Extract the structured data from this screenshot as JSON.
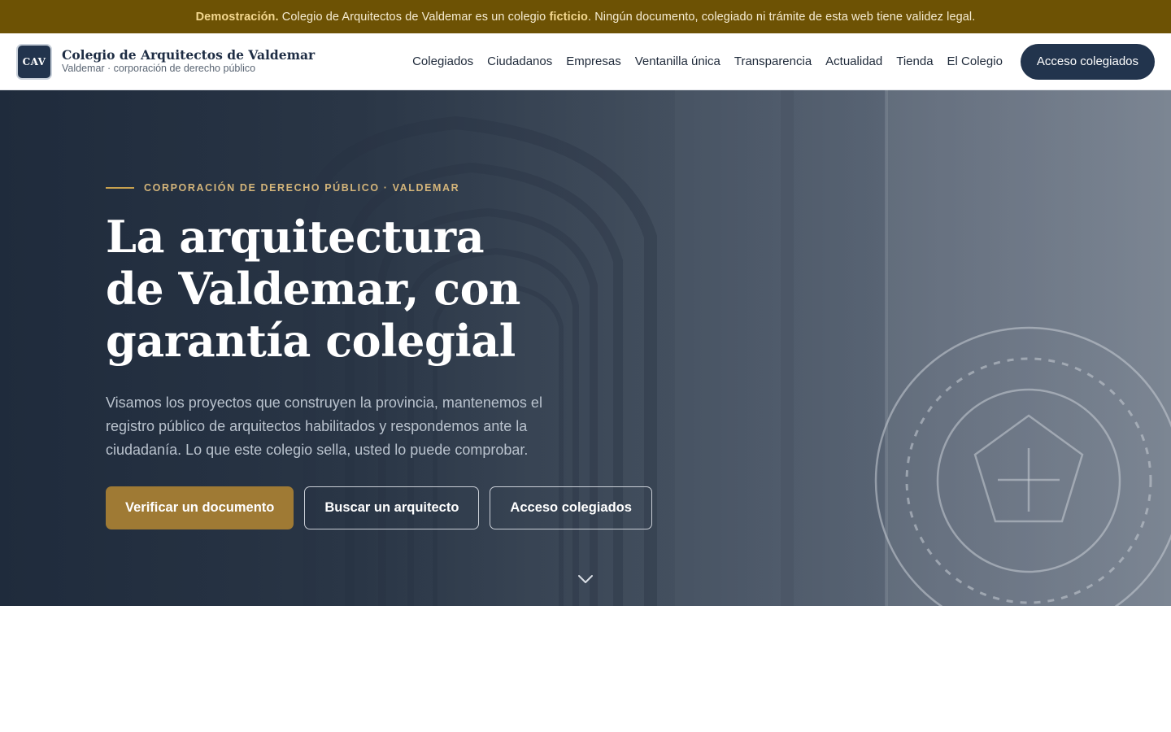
{
  "banner": {
    "label": "Demostración.",
    "text_before": " Colegio de Arquitectos de Valdemar es un colegio ",
    "emphasis": "ficticio",
    "text_after": ". Ningún documento, colegiado ni trámite de esta web tiene validez legal."
  },
  "header": {
    "logo_text": "CAV",
    "brand_name": "Colegio de Arquitectos de Valdemar",
    "brand_subtitle": "Valdemar · corporación de derecho público",
    "nav": [
      {
        "label": "Colegiados"
      },
      {
        "label": "Ciudadanos"
      },
      {
        "label": "Empresas"
      },
      {
        "label": "Ventanilla única"
      },
      {
        "label": "Transparencia"
      },
      {
        "label": "Actualidad"
      },
      {
        "label": "Tienda"
      },
      {
        "label": "El Colegio"
      }
    ],
    "cta_label": "Acceso colegiados"
  },
  "hero": {
    "eyebrow": "CORPORACIÓN DE DERECHO PÚBLICO · VALDEMAR",
    "title": "La arquitectura de Valdemar, con garantía colegial",
    "lead": "Visamos los proyectos que construyen la provincia, mantenemos el registro público de arquitectos habilitados y respondemos ante la ciudadanía. Lo que este colegio sella, usted lo puede comprobar.",
    "actions": {
      "primary": "Verificar un documento",
      "secondary": "Buscar un arquitecto",
      "tertiary": "Acceso colegiados"
    }
  },
  "colors": {
    "banner_bg": "#6d5204",
    "brand_navy": "#22344d",
    "accent_gold": "#9f7a34"
  },
  "icons": {
    "scroll": "chevron-down-icon",
    "seal": "pentagon-cross-seal-icon"
  }
}
